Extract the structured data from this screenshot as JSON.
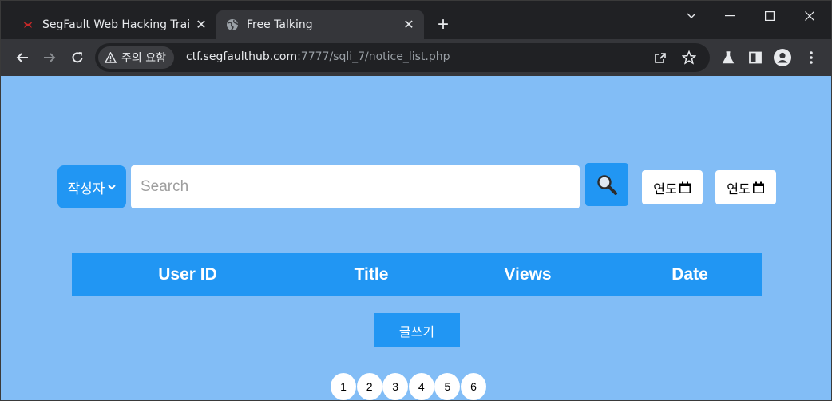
{
  "browser": {
    "tabs": [
      {
        "title": "SegFault Web Hacking Trai",
        "icon": "segfault-logo-icon",
        "active": false
      },
      {
        "title": "Free Talking",
        "icon": "globe-icon",
        "active": true
      }
    ],
    "new_tab_label": "+",
    "security_label": "주의 요함",
    "url_host": "ctf.segfaulthub.com",
    "url_path": ":7777/sqli_7/notice_list.php"
  },
  "page": {
    "category_select": {
      "selected": "작성자"
    },
    "search": {
      "placeholder": "Search",
      "value": ""
    },
    "date_from_label": "연도",
    "date_to_label": "연도",
    "table": {
      "columns": [
        "User ID",
        "Title",
        "Views",
        "Date"
      ],
      "rows": []
    },
    "write_button": "글쓰기",
    "pagination": [
      "1",
      "2",
      "3",
      "4",
      "5",
      "6"
    ]
  },
  "colors": {
    "page_background": "#82bdf6",
    "accent": "#2196f3",
    "chrome_dark": "#202124",
    "chrome_toolbar": "#35363a"
  }
}
